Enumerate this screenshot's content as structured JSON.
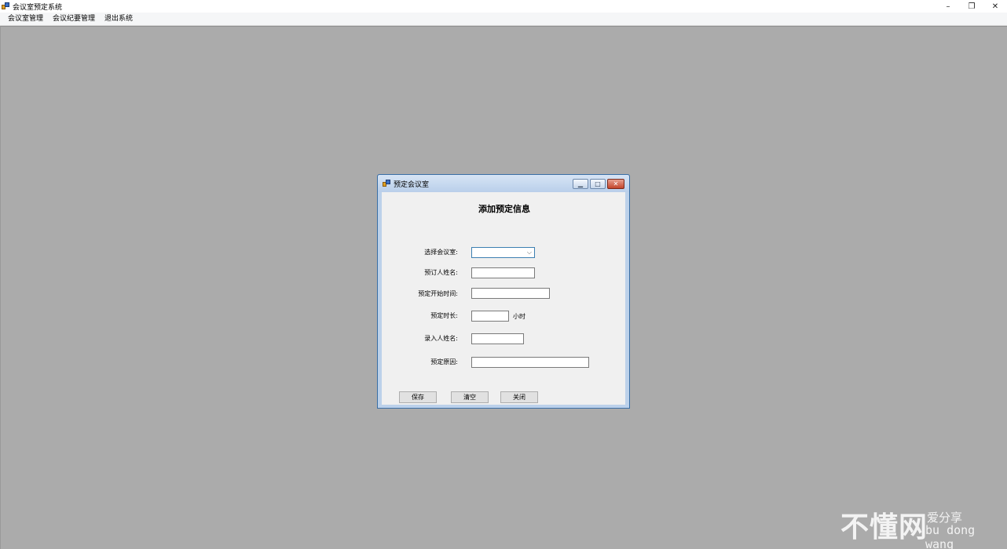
{
  "window": {
    "title": "会议室预定系统",
    "controls": {
      "minimize": "–",
      "restore": "❐",
      "close": "✕"
    }
  },
  "menu": {
    "items": [
      "会议室管理",
      "会议纪要管理",
      "退出系统"
    ]
  },
  "dialog": {
    "title": "预定会议室",
    "heading": "添加预定信息",
    "labels": {
      "room": "选择会议室:",
      "booker": "预订人姓名:",
      "start": "预定开始时间:",
      "duration": "预定时长:",
      "entry": "录入人姓名:",
      "reason": "预定原因:"
    },
    "values": {
      "room": "",
      "booker": "",
      "start": "",
      "duration": "",
      "entry": "",
      "reason": ""
    },
    "duration_unit": "小时",
    "buttons": {
      "save": "保存",
      "clear": "清空",
      "close": "关闭"
    }
  },
  "watermark": {
    "main": "不懂网",
    "slogan": "爱分享",
    "pinyin": "bu dong wang"
  },
  "colors": {
    "workspace": "#ababab",
    "dialog_frame": "#bcd1ea",
    "dialog_client": "#f0f0f0",
    "close_button": "#c3452b"
  }
}
